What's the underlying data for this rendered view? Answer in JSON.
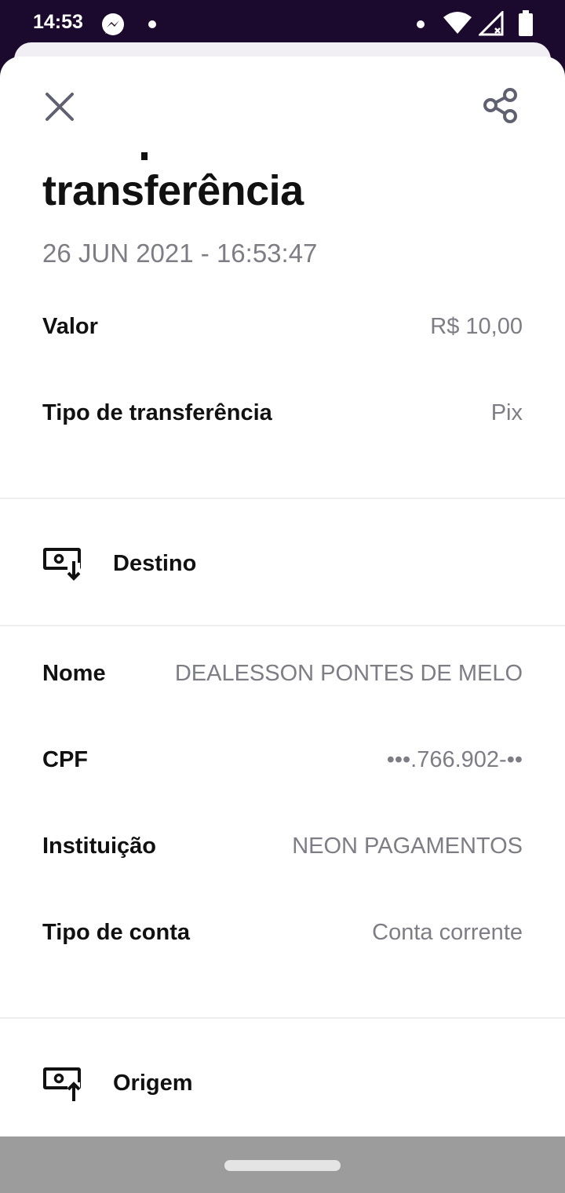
{
  "status_bar": {
    "time": "14:53"
  },
  "header": {
    "title": "transferência"
  },
  "datetime": "26 JUN 2021 - 16:53:47",
  "summary": [
    {
      "label": "Valor",
      "value": "R$ 10,00"
    },
    {
      "label": "Tipo de transferência",
      "value": "Pix"
    }
  ],
  "destino": {
    "label": "Destino",
    "fields": [
      {
        "label": "Nome",
        "value": "DEALESSON PONTES DE MELO"
      },
      {
        "label": "CPF",
        "value": "•••.766.902-••"
      },
      {
        "label": "Instituição",
        "value": "NEON PAGAMENTOS"
      },
      {
        "label": "Tipo de conta",
        "value": "Conta corrente"
      }
    ]
  },
  "origem": {
    "label": "Origem"
  },
  "colors": {
    "status_bar_bg": "#1c0a2e",
    "text_primary": "#111111",
    "text_secondary": "#7d7d85",
    "icon_color": "#5f6170"
  }
}
